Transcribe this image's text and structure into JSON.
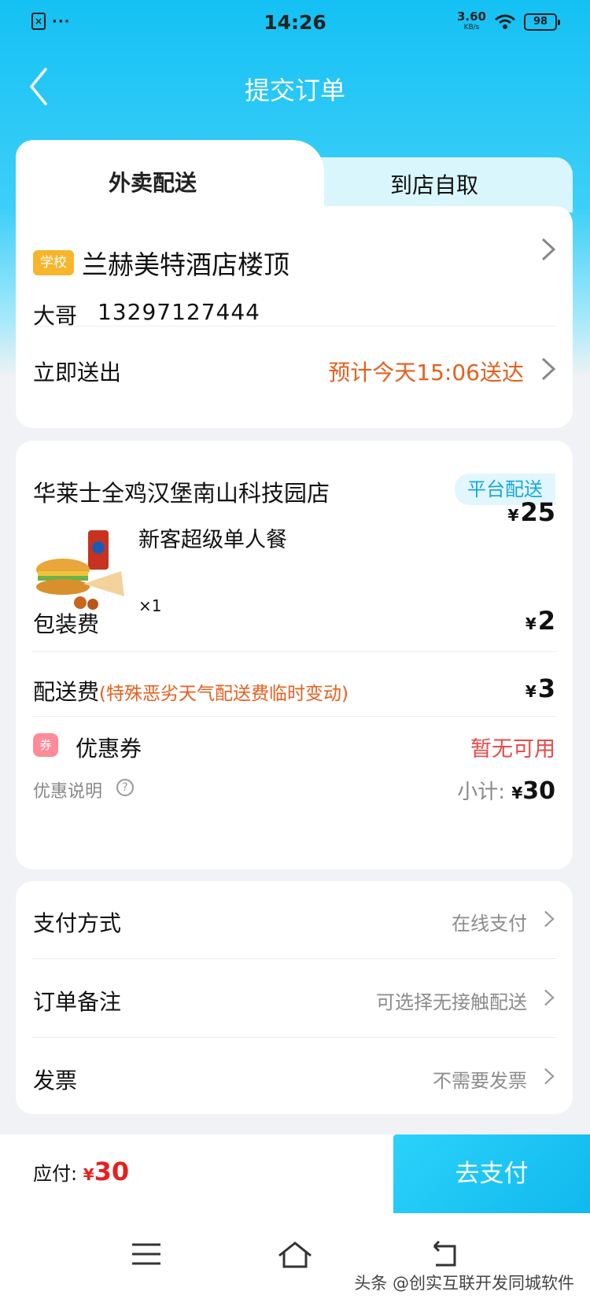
{
  "status_bar": {
    "time": "14:26",
    "speed": "3.60",
    "speed_unit": "KB/s",
    "battery": "98"
  },
  "header": {
    "title": "提交订单"
  },
  "tabs": [
    {
      "label": "外卖配送",
      "active": true
    },
    {
      "label": "到店自取",
      "active": false
    }
  ],
  "address": {
    "tag": "学校",
    "name": "兰赫美特酒店楼顶",
    "contact": "大哥",
    "phone": "13297127444"
  },
  "delivery": {
    "label": "立即送出",
    "eta": "预计今天15:06送达"
  },
  "order": {
    "shop": "华莱士全鸡汉堡南山科技园店",
    "delivery_badge": "平台配送",
    "item": {
      "name": "新客超级单人餐",
      "qty": "×1",
      "price": "25"
    },
    "packaging": {
      "label": "包装费",
      "price": "2"
    },
    "delivery_fee": {
      "label": "配送费",
      "note": "(特殊恶劣天气配送费临时变动)",
      "price": "3"
    },
    "coupon": {
      "icon_text": "券",
      "label": "优惠券",
      "value": "暂无可用"
    },
    "discount_desc": "优惠说明",
    "subtotal_label": "小计:",
    "subtotal": "30",
    "currency": "¥"
  },
  "options": [
    {
      "label": "支付方式",
      "value": "在线支付"
    },
    {
      "label": "订单备注",
      "value": "可选择无接触配送"
    },
    {
      "label": "发票",
      "value": "不需要发票"
    }
  ],
  "footer": {
    "due_label": "应付:",
    "due_amount": "30",
    "pay_button": "去支付"
  },
  "watermark": "头条 @创实互联开发同城软件",
  "colors": {
    "brand": "#14c1f4",
    "eta": "#e5601f",
    "price_red": "#e62020",
    "school_badge": "#f7b52c"
  }
}
